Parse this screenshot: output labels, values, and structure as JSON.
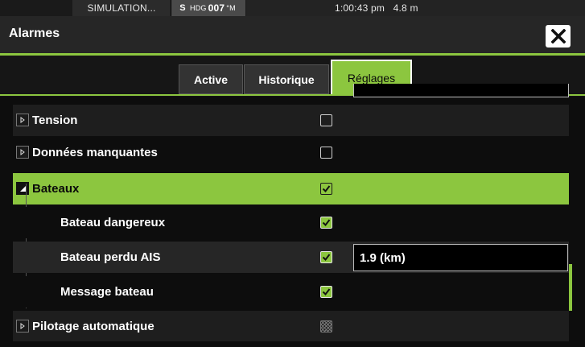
{
  "status_bar": {
    "simulation": "SIMULATION...",
    "heading_prefix": "S",
    "heading_label": "HDG",
    "heading_value": "007",
    "heading_unit": "°M",
    "time_range": "1:00:43 pm   4.8 m"
  },
  "header": {
    "title": "Alarmes",
    "close_icon": "close-icon"
  },
  "tabs": [
    {
      "label": "Active",
      "selected": false
    },
    {
      "label": "Historique",
      "selected": false
    },
    {
      "label": "Réglages",
      "selected": true
    }
  ],
  "rows": [
    {
      "label": "Tension",
      "checked": false,
      "expandable": true,
      "expanded": false
    },
    {
      "label": "Données manquantes",
      "checked": false,
      "expandable": true,
      "expanded": false
    },
    {
      "label": "Bateaux",
      "checked": true,
      "expandable": true,
      "expanded": true,
      "selected": true
    },
    {
      "label": "Bateau dangereux",
      "checked": true,
      "child": true
    },
    {
      "label": "Bateau perdu AIS",
      "checked": true,
      "child": true,
      "value": "1.9 (km)"
    },
    {
      "label": "Message bateau",
      "checked": true,
      "child": true
    },
    {
      "label": "Pilotage automatique",
      "checked": false,
      "disabled": true,
      "expandable": true,
      "expanded": false
    }
  ],
  "colors": {
    "accent": "#8cc63f",
    "background": "#0d0d0d",
    "row_dark": "#1e1e1e",
    "row_mid": "#262626"
  }
}
